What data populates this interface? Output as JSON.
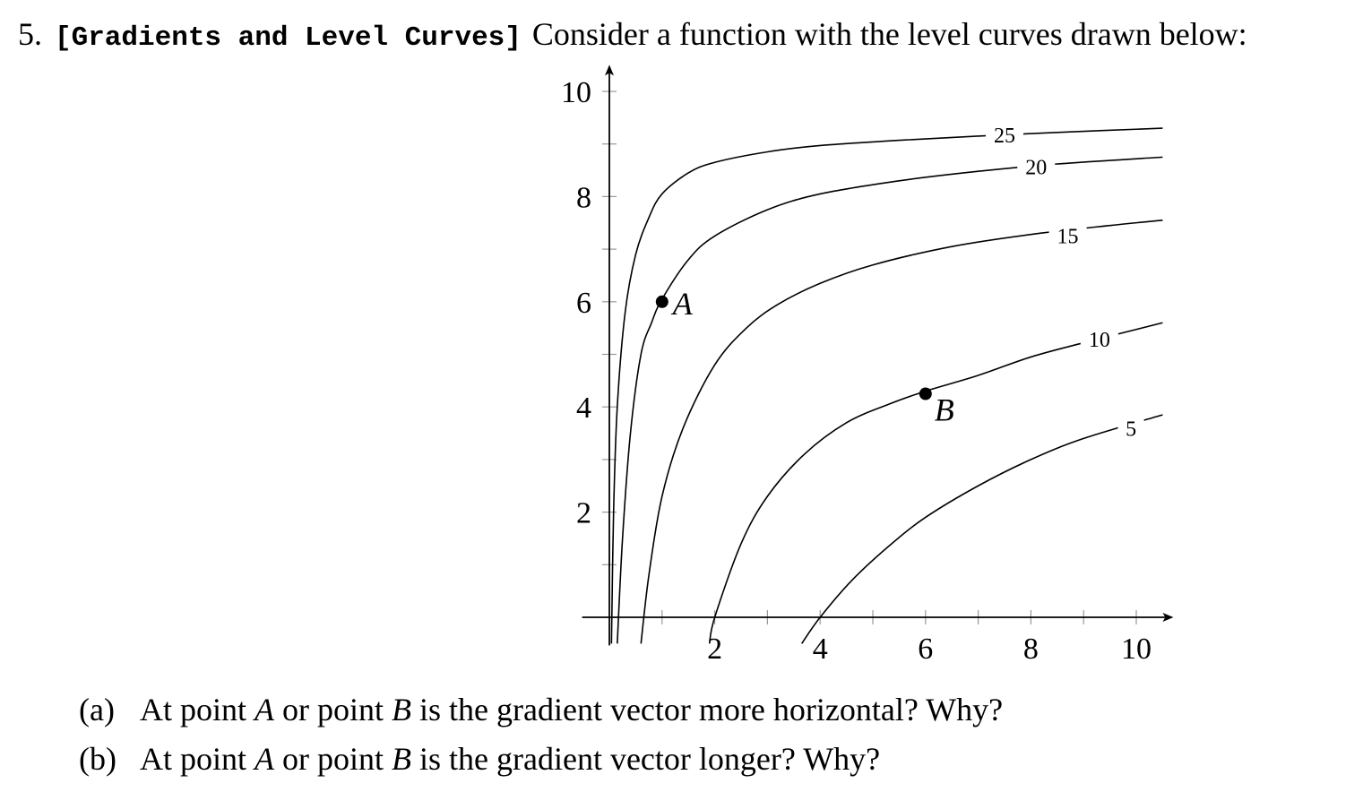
{
  "problem": {
    "number": "5.",
    "title": "[Gradients and Level Curves]",
    "statement": "Consider a function with the level curves drawn below:"
  },
  "chart_data": {
    "type": "line",
    "title": "",
    "xlabel": "",
    "ylabel": "",
    "xlim": [
      -0.5,
      10.5
    ],
    "ylim": [
      -0.5,
      10.3
    ],
    "grid": false,
    "x_ticks": [
      1,
      2,
      3,
      4,
      5,
      6,
      7,
      8,
      9,
      10
    ],
    "x_tick_labels": [
      "2",
      "4",
      "6",
      "8",
      "10"
    ],
    "x_tick_label_values": [
      2,
      4,
      6,
      8,
      10
    ],
    "y_ticks": [
      1,
      2,
      3,
      4,
      5,
      6,
      7,
      8,
      9,
      10
    ],
    "y_tick_labels": [
      "2",
      "4",
      "6",
      "8",
      "10"
    ],
    "y_tick_label_values": [
      2,
      4,
      6,
      8,
      10
    ],
    "series": [
      {
        "name": "25",
        "label_at": [
          7.5,
          9.18
        ],
        "x": [
          0.04,
          0.08,
          0.15,
          0.3,
          0.5,
          0.75,
          1.0,
          1.5,
          2.0,
          3.0,
          4.0,
          5.5,
          7.0,
          8.5,
          10.5
        ],
        "y": [
          -0.5,
          2.0,
          4.0,
          5.8,
          6.9,
          7.6,
          8.05,
          8.45,
          8.65,
          8.85,
          8.97,
          9.07,
          9.15,
          9.22,
          9.3
        ]
      },
      {
        "name": "20",
        "label_at": [
          8.1,
          8.58
        ],
        "x": [
          0.15,
          0.25,
          0.4,
          0.6,
          0.8,
          1.0,
          1.5,
          2.0,
          3.0,
          4.0,
          5.5,
          7.0,
          8.5,
          10.5
        ],
        "y": [
          -0.5,
          1.5,
          3.5,
          5.0,
          5.6,
          6.05,
          6.8,
          7.25,
          7.75,
          8.05,
          8.3,
          8.48,
          8.62,
          8.75
        ]
      },
      {
        "name": "15",
        "label_at": [
          8.7,
          7.27
        ],
        "x": [
          0.6,
          0.75,
          1.0,
          1.4,
          2.0,
          2.6,
          3.2,
          4.0,
          5.0,
          6.5,
          8.0,
          9.5,
          10.5
        ],
        "y": [
          -0.5,
          0.8,
          2.3,
          3.6,
          4.8,
          5.5,
          5.95,
          6.35,
          6.7,
          7.05,
          7.28,
          7.45,
          7.55
        ]
      },
      {
        "name": "10",
        "label_at": [
          9.3,
          5.3
        ],
        "x": [
          1.9,
          2.0,
          2.5,
          3.0,
          3.7,
          4.5,
          5.3,
          6.0,
          7.0,
          8.0,
          9.0,
          10.5
        ],
        "y": [
          -0.5,
          0.0,
          1.4,
          2.3,
          3.1,
          3.7,
          4.05,
          4.3,
          4.6,
          4.95,
          5.22,
          5.6
        ]
      },
      {
        "name": "5",
        "label_at": [
          9.9,
          3.6
        ],
        "x": [
          3.65,
          4.0,
          4.6,
          5.3,
          6.0,
          7.0,
          8.0,
          9.0,
          10.5
        ],
        "y": [
          -0.5,
          0.0,
          0.7,
          1.35,
          1.9,
          2.5,
          3.0,
          3.4,
          3.85
        ]
      }
    ],
    "points": [
      {
        "label": "A",
        "x": 1.0,
        "y": 6.0
      },
      {
        "label": "B",
        "x": 6.0,
        "y": 4.25
      }
    ]
  },
  "questions": [
    {
      "label": "(a)",
      "pre": "At point ",
      "p1": "A",
      "mid": " or point ",
      "p2": "B",
      "post": " is the gradient vector more horizontal? Why?"
    },
    {
      "label": "(b)",
      "pre": "At point ",
      "p1": "A",
      "mid": " or point ",
      "p2": "B",
      "post": " is the gradient vector longer? Why?"
    }
  ]
}
